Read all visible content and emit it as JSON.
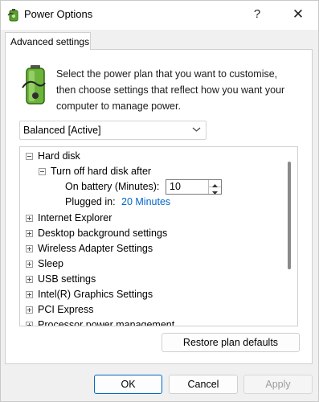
{
  "window": {
    "title": "Power Options",
    "help_label": "?",
    "close_label": "✕"
  },
  "tab": {
    "label": "Advanced settings"
  },
  "intro_text": "Select the power plan that you want to customise, then choose settings that reflect how you want your computer to manage power.",
  "plan_select": {
    "value": "Balanced [Active]"
  },
  "tree": {
    "hard_disk": "Hard disk",
    "turn_off": "Turn off hard disk after",
    "on_battery_label": "On battery (Minutes):",
    "on_battery_value": "10",
    "plugged_in_label": "Plugged in:",
    "plugged_in_value": "20 Minutes",
    "items": [
      "Internet Explorer",
      "Desktop background settings",
      "Wireless Adapter Settings",
      "Sleep",
      "USB settings",
      "Intel(R) Graphics Settings",
      "PCI Express",
      "Processor power management"
    ]
  },
  "buttons": {
    "restore": "Restore plan defaults",
    "ok": "OK",
    "cancel": "Cancel",
    "apply": "Apply"
  }
}
